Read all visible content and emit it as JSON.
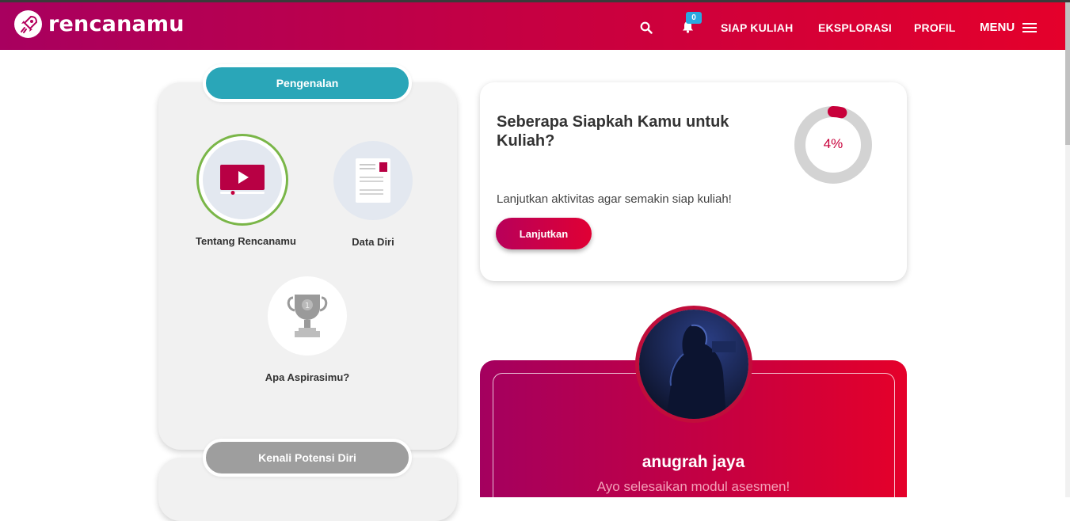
{
  "brand": {
    "name": "rencanamu"
  },
  "nav": {
    "notif_count": "0",
    "links": [
      "SIAP KULIAH",
      "EKSPLORASI",
      "PROFIL"
    ],
    "menu_label": "MENU"
  },
  "sections": [
    {
      "title": "Pengenalan",
      "items": [
        {
          "label": "Tentang Rencanamu",
          "icon": "video-play-icon"
        },
        {
          "label": "Data Diri",
          "icon": "document-icon"
        },
        {
          "label": "Apa Aspirasimu?",
          "icon": "trophy-icon"
        }
      ]
    },
    {
      "title": "Kenali Potensi Diri"
    }
  ],
  "readiness": {
    "title": "Seberapa Siapkah Kamu untuk Kuliah?",
    "percent_label": "4%",
    "percent_value": 4,
    "subtitle": "Lanjutkan aktivitas agar semakin siap kuliah!",
    "button": "Lanjutkan"
  },
  "profile": {
    "name": "anugrah jaya",
    "message": "Ayo selesaikan modul asesmen!"
  },
  "colors": {
    "brand_start": "#a8005f",
    "brand_end": "#e4002b",
    "teal": "#2aa6b8",
    "grey_pill": "#9e9e9e",
    "selected_ring": "#7ab648"
  }
}
